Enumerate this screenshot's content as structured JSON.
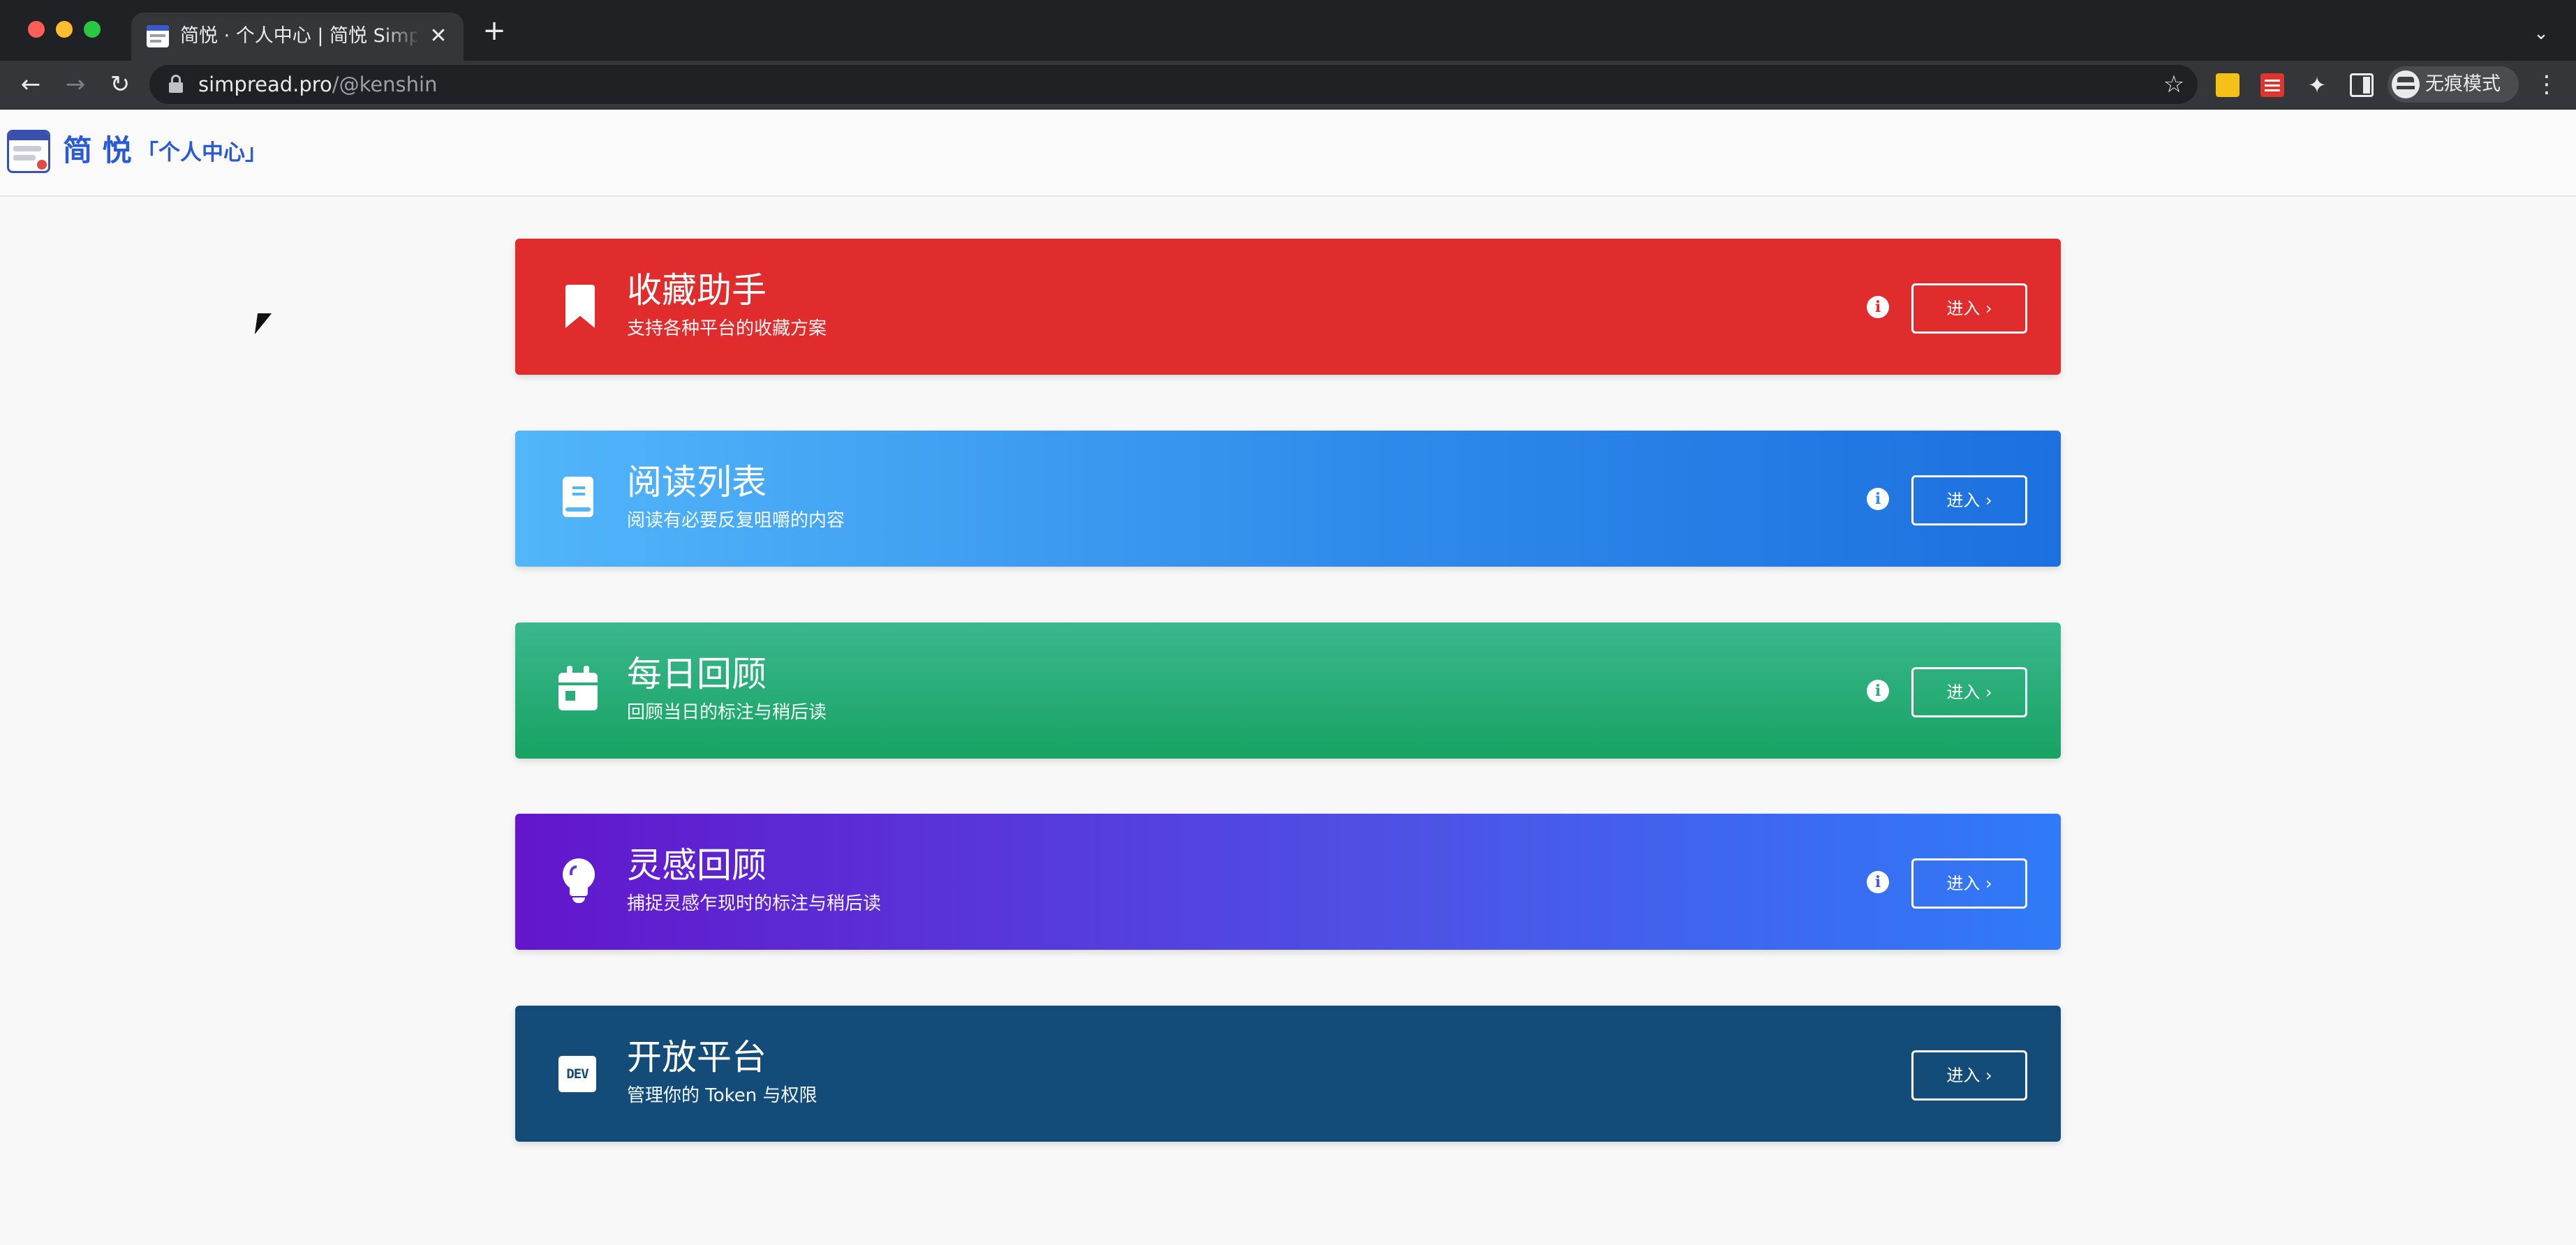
{
  "browser": {
    "tab": {
      "title": "简悦 · 个人中心 | 简悦 SimpRead",
      "close_glyph": "✕"
    },
    "new_tab_glyph": "+",
    "tab_menu_glyph": "⌄",
    "nav": {
      "back_glyph": "←",
      "forward_glyph": "→",
      "reload_glyph": "↻"
    },
    "address": {
      "host": "simpread.pro",
      "path": "/@kenshin"
    },
    "bookmark_star_glyph": "☆",
    "extensions_glyph": "✦",
    "incognito_label": "无痕模式",
    "menu_glyph": "⋮",
    "icons": [
      "lock-icon",
      "star-icon",
      "extension-icon",
      "puzzle-icon",
      "sidepanel-icon",
      "incognito-icon"
    ]
  },
  "header": {
    "brand": "简 悦",
    "subtitle": "「个人中心」"
  },
  "cards": [
    {
      "icon": "bookmark-icon",
      "title": "收藏助手",
      "subtitle": "支持各种平台的收藏方案",
      "button": "进入 ›",
      "has_info": true,
      "color": "#e02c2c"
    },
    {
      "icon": "book-icon",
      "title": "阅读列表",
      "subtitle": "阅读有必要反复咀嚼的内容",
      "button": "进入 ›",
      "has_info": true,
      "color": "#2f8bea"
    },
    {
      "icon": "calendar-icon",
      "title": "每日回顾",
      "subtitle": "回顾当日的标注与稍后读",
      "button": "进入 ›",
      "has_info": true,
      "color": "#25ad77"
    },
    {
      "icon": "lightbulb-icon",
      "title": "灵感回顾",
      "subtitle": "捕捉灵感乍现时的标注与稍后读",
      "button": "进入 ›",
      "has_info": true,
      "color": "#4a57e6"
    },
    {
      "icon": "dev-icon",
      "icon_text": "DEV",
      "title": "开放平台",
      "subtitle": "管理你的 Token 与权限",
      "button": "进入 ›",
      "has_info": false,
      "color": "#134c79"
    }
  ],
  "info_glyph": "i"
}
